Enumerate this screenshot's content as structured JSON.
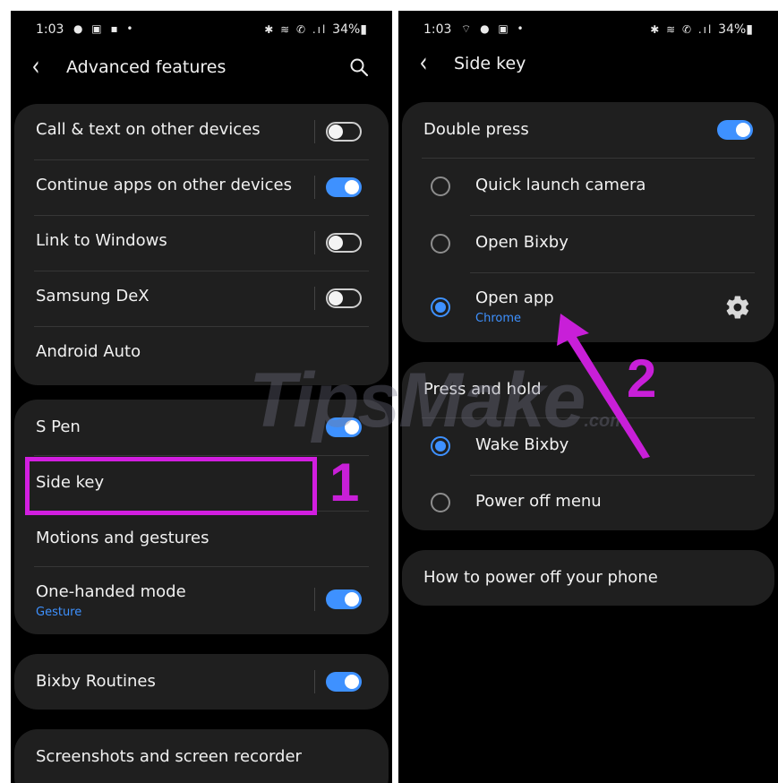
{
  "left_screen": {
    "status": {
      "time": "1:03",
      "notif_icons": "● ▣ ▪ •",
      "sys_icons": "✱ ≋ ✆ .ıl",
      "battery": "34%▮"
    },
    "header": {
      "back_icon": "back-arrow-icon",
      "title": "Advanced features",
      "search_icon": "search-icon"
    },
    "group1": [
      {
        "label": "Call & text on other devices",
        "toggle": "off"
      },
      {
        "label": "Continue apps on other devices",
        "toggle": "on"
      },
      {
        "label": "Link to Windows",
        "toggle": "off"
      },
      {
        "label": "Samsung DeX",
        "toggle": "off"
      },
      {
        "label": "Android Auto"
      }
    ],
    "group2": [
      {
        "label": "S Pen",
        "toggle": "on"
      },
      {
        "label": "Side key"
      },
      {
        "label": "Motions and gestures"
      },
      {
        "label": "One-handed mode",
        "sublabel": "Gesture",
        "toggle": "on"
      }
    ],
    "group3": [
      {
        "label": "Bixby Routines",
        "toggle": "on"
      }
    ],
    "group4": [
      {
        "label": "Screenshots and screen recorder"
      }
    ]
  },
  "right_screen": {
    "status": {
      "time": "1:03",
      "notif_icons": "⌔ ● ▣ •",
      "sys_icons": "✱ ≋ ✆ .ıl",
      "battery": "34%▮"
    },
    "header": {
      "back_icon": "back-arrow-icon",
      "title": "Side key"
    },
    "double_press": {
      "title": "Double press",
      "toggle": "on",
      "options": [
        {
          "label": "Quick launch camera",
          "selected": false
        },
        {
          "label": "Open Bixby",
          "selected": false
        },
        {
          "label": "Open app",
          "sublabel": "Chrome",
          "selected": true,
          "gear_icon": "gear-icon"
        }
      ]
    },
    "press_and_hold": {
      "title": "Press and hold",
      "options": [
        {
          "label": "Wake Bixby",
          "selected": true
        },
        {
          "label": "Power off menu",
          "selected": false
        }
      ]
    },
    "help": {
      "label": "How to power off your phone"
    }
  },
  "annotations": {
    "step1": "1",
    "step2": "2",
    "color": "#c81fd8"
  },
  "watermark": {
    "text": "TipsMake",
    "suffix": ".com"
  },
  "colors": {
    "accent": "#3e91ff",
    "background": "#000000",
    "card": "#1f1f1f",
    "annotation": "#d21ee0"
  }
}
